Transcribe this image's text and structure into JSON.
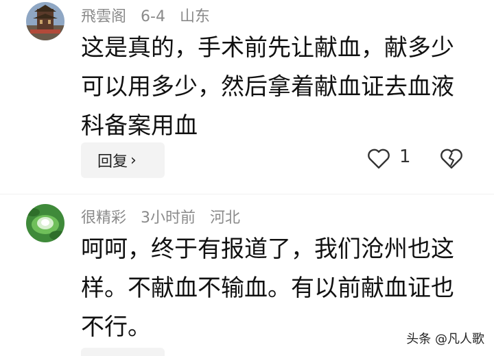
{
  "comments": [
    {
      "username": "飛雲阁",
      "date": "6-4",
      "location": "山东",
      "text": "这是真的，手术前先让献血，献多少可以用多少，然后拿着献血证去血液科备案用血",
      "reply_label": "回复",
      "like_count": "1"
    },
    {
      "username": "很精彩",
      "date": "3小时前",
      "location": "河北",
      "text": "呵呵，终于有报道了，我们沧州也这样。不献血不输血。有以前献血证也不行。"
    }
  ],
  "watermark": "头条 @凡人歌",
  "colors": {
    "meta": "#8a8a8a",
    "text": "#111111",
    "reply_bg": "#f3f3f3"
  }
}
